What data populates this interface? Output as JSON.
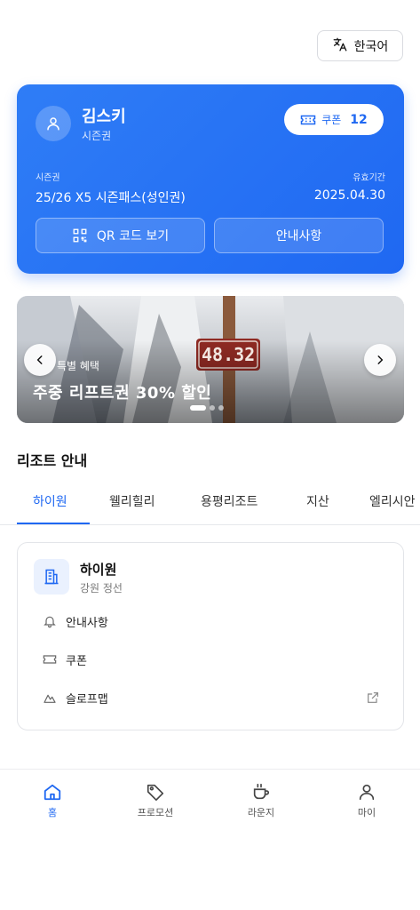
{
  "header": {
    "language_label": "한국어"
  },
  "pass_card": {
    "user_name": "김스키",
    "user_subtitle": "시즌권",
    "coupon_label": "쿠폰",
    "coupon_count": "12",
    "pass_label": "시즌권",
    "pass_name": "25/26 X5 시즌패스(성인권)",
    "expiry_label": "유효기간",
    "expiry_date": "2025.04.30",
    "qr_button_label": "QR 코드 보기",
    "info_button_label": "안내사항",
    "accent_color": "#1f68f2"
  },
  "banner": {
    "eyebrow": "특별 혜택",
    "title": "주중 리프트권 30% 할인",
    "sign_text": "48.32",
    "slide_count": 3,
    "active_slide": 1
  },
  "resort_section": {
    "title": "리조트 안내",
    "tabs": [
      {
        "label": "하이원",
        "active": true
      },
      {
        "label": "웰리힐리",
        "active": false
      },
      {
        "label": "용평리조트",
        "active": false
      },
      {
        "label": "지산",
        "active": false
      },
      {
        "label": "엘리시안",
        "active": false
      }
    ],
    "card": {
      "name": "하이원",
      "region": "강원 정선",
      "rows": [
        {
          "label": "안내사항",
          "icon": "bell-icon"
        },
        {
          "label": "쿠폰",
          "icon": "ticket-icon"
        },
        {
          "label": "슬로프맵",
          "icon": "mountain-icon",
          "external": true
        }
      ]
    }
  },
  "bottom_nav": {
    "items": [
      {
        "label": "홈",
        "icon": "home-icon",
        "active": true
      },
      {
        "label": "프로모션",
        "icon": "tag-icon",
        "active": false
      },
      {
        "label": "라운지",
        "icon": "coffee-icon",
        "active": false
      },
      {
        "label": "마이",
        "icon": "user-icon",
        "active": false
      }
    ]
  }
}
